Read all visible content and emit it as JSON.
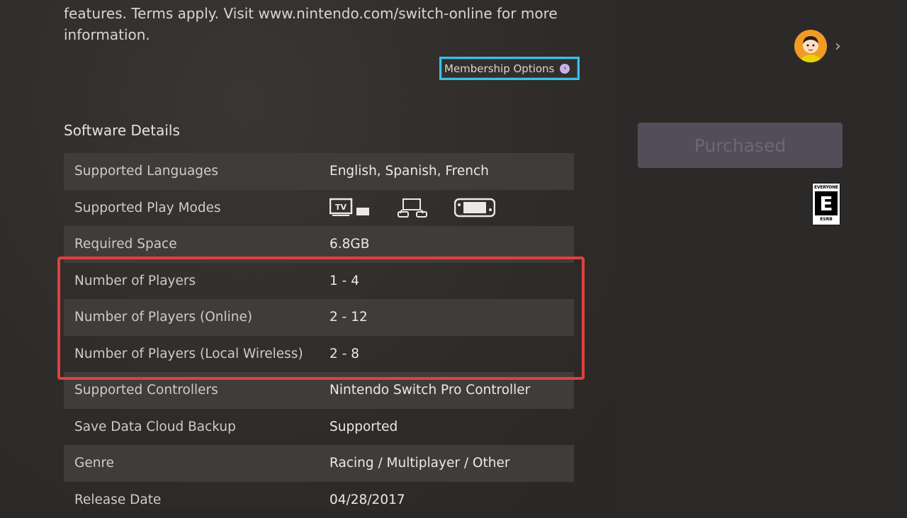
{
  "notice_text": "features. Terms apply. Visit www.nintendo.com/switch-online for more information.",
  "membership_button": "Membership Options",
  "section_title": "Software Details",
  "rows": [
    {
      "label": "Supported Languages",
      "value": "English, Spanish, French"
    },
    {
      "label": "Supported Play Modes",
      "value": ""
    },
    {
      "label": "Required Space",
      "value": "6.8GB"
    },
    {
      "label": "Number of Players",
      "value": "1 - 4"
    },
    {
      "label": "Number of Players (Online)",
      "value": "2 - 12"
    },
    {
      "label": "Number of Players (Local Wireless)",
      "value": "2 - 8"
    },
    {
      "label": "Supported Controllers",
      "value": "Nintendo Switch Pro Controller"
    },
    {
      "label": "Save Data Cloud Backup",
      "value": "Supported"
    },
    {
      "label": "Genre",
      "value": "Racing / Multiplayer / Other"
    },
    {
      "label": "Release Date",
      "value": "04/28/2017"
    }
  ],
  "play_mode_icons": {
    "tv_label": "TV",
    "tabletop": "tabletop-mode-icon",
    "handheld": "handheld-mode-icon"
  },
  "purchase_button": "Purchased",
  "rating": {
    "top": "EVERYONE",
    "letter": "E",
    "bottom": "ESRB"
  },
  "colors": {
    "highlight": "#e0403f",
    "focus": "#39c1e8",
    "purchased_bg": "#524d58"
  }
}
